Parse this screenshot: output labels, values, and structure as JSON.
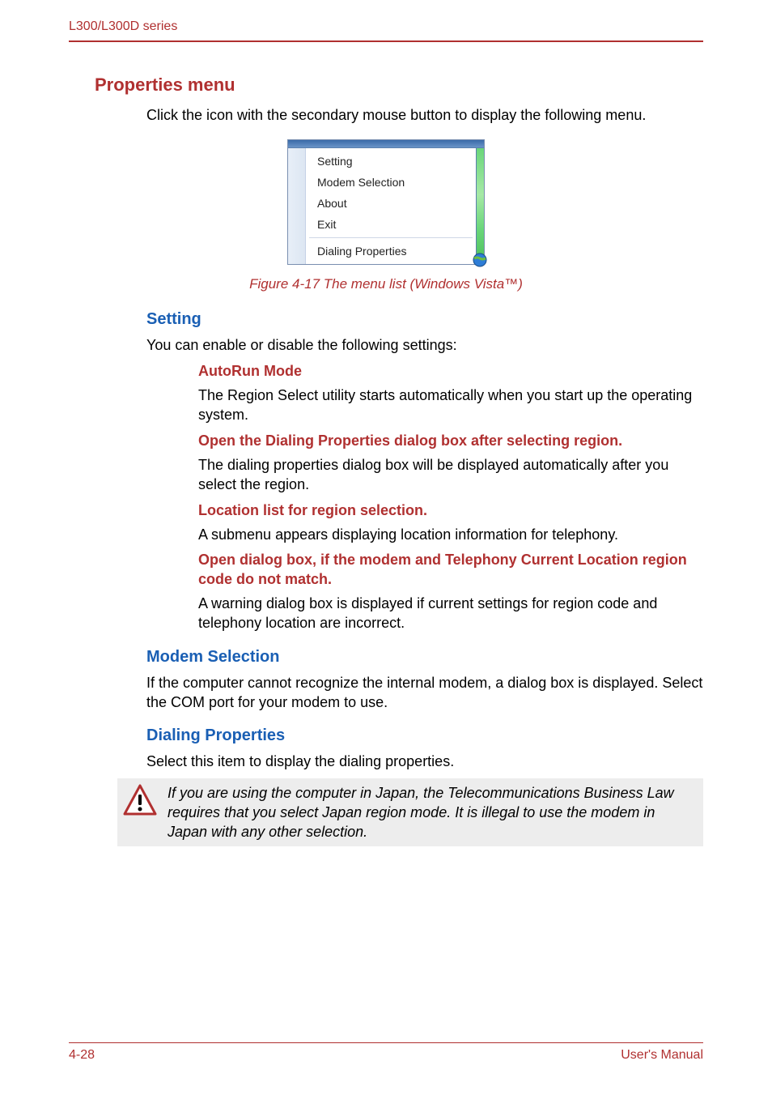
{
  "header": {
    "series": "L300/L300D series"
  },
  "sections": {
    "properties_menu": {
      "title": "Properties menu",
      "intro": "Click the icon with the secondary mouse button to display the following menu."
    },
    "context_menu": {
      "items": [
        "Setting",
        "Modem Selection",
        "About",
        "Exit"
      ],
      "separated_item": "Dialing Properties"
    },
    "figure_caption": "Figure 4-17 The menu list (Windows Vista™)",
    "setting": {
      "title": "Setting",
      "intro": "You can enable or disable the following settings:",
      "autorun": {
        "title": "AutoRun Mode",
        "body": "The Region Select utility starts automatically when you start up the operating system."
      },
      "open_dialing": {
        "title": "Open the Dialing Properties dialog box after selecting region.",
        "body": "The dialing properties dialog box will be displayed automatically after you select the region."
      },
      "location_list": {
        "title": "Location list for region selection.",
        "body": "A submenu appears displaying location information for telephony."
      },
      "open_dialog_mismatch": {
        "title": "Open dialog box, if the modem and Telephony Current Location region code do not match.",
        "body": "A warning dialog box is displayed if current settings for region code and telephony location are incorrect."
      }
    },
    "modem_selection": {
      "title": "Modem Selection",
      "body": "If the computer cannot recognize the internal modem, a dialog box is displayed. Select the COM port for your modem to use."
    },
    "dialing_properties": {
      "title": "Dialing Properties",
      "body": "Select this item to display the dialing properties."
    },
    "warning": {
      "text": "If you are using the computer in Japan, the Telecommunications Business Law requires that you select Japan region mode. It is illegal to use the modem in Japan with any other selection."
    }
  },
  "footer": {
    "page": "4-28",
    "manual": "User's Manual"
  }
}
